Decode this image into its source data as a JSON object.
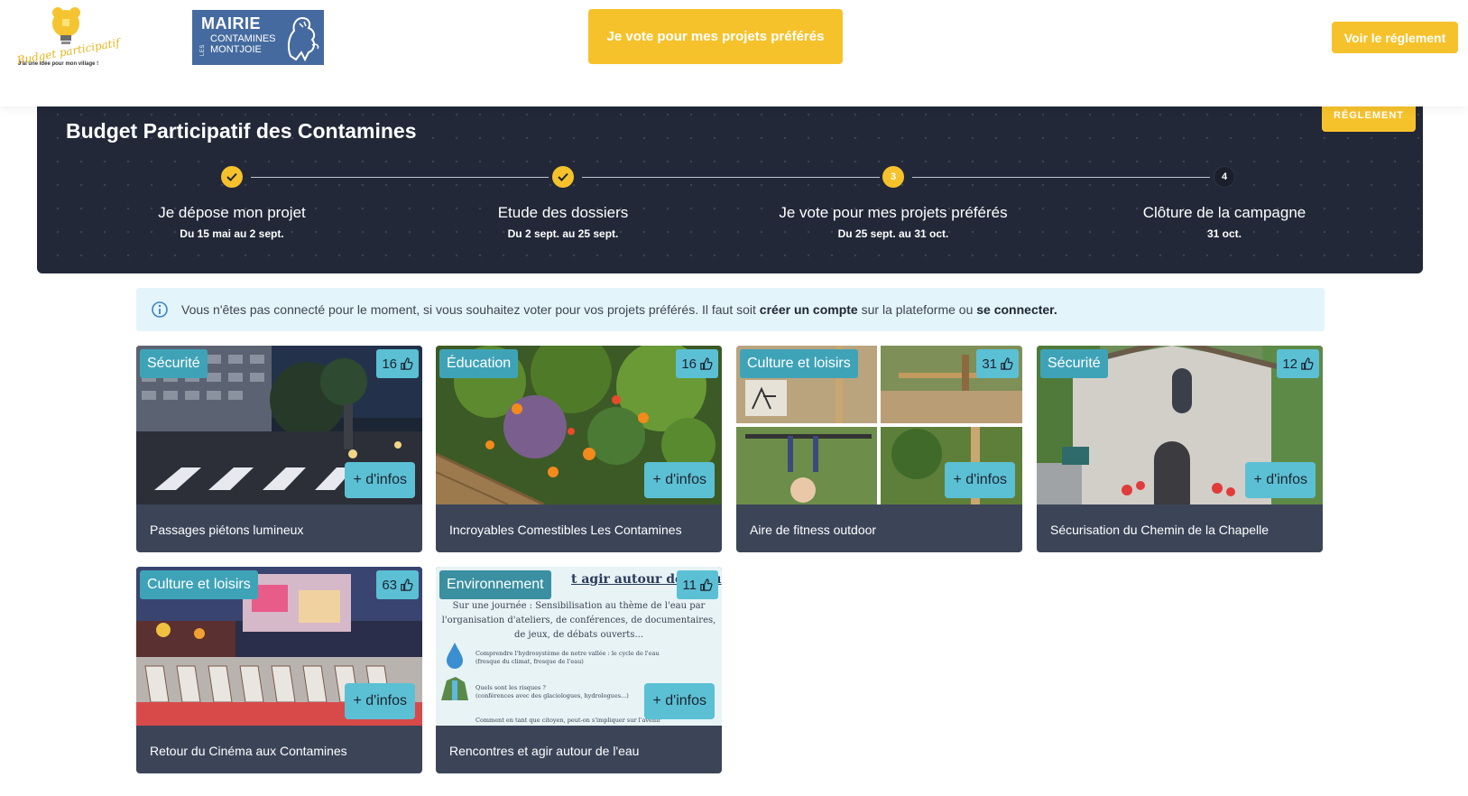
{
  "header": {
    "logo_budget": {
      "line1": "Budget participatif",
      "line2": "J'ai une idée pour mon village !"
    },
    "logo_mairie": {
      "line1": "MAIRIE",
      "line2": "LES",
      "line3": "CONTAMINES",
      "line4": "MONTJOIE"
    },
    "vote_button": "Je vote pour mes projets préférés",
    "rules_button": "Voir le réglement"
  },
  "banner": {
    "title": "Budget Participatif des Contamines",
    "rules_tab": "RÉGLEMENT",
    "steps": [
      {
        "label": "Je dépose mon projet",
        "date": "Du 15 mai au 2 sept.",
        "state": "done",
        "number": ""
      },
      {
        "label": "Etude des dossiers",
        "date": "Du 2 sept. au 25 sept.",
        "state": "done",
        "number": ""
      },
      {
        "label": "Je vote pour mes projets préférés",
        "date": "Du 25 sept. au 31 oct.",
        "state": "current",
        "number": "3"
      },
      {
        "label": "Clôture de la campagne",
        "date": "31 oct.",
        "state": "future",
        "number": "4"
      }
    ]
  },
  "info": {
    "text_before": "Vous n'êtes pas connecté pour le moment, si vous souhaitez voter pour vos projets préférés. Il faut soit ",
    "link_create": "créer un compte",
    "text_middle": " sur la plateforme ou ",
    "link_login": "se connecter."
  },
  "more_label": "+ d'infos",
  "projects": [
    {
      "category": "Sécurité",
      "votes": "16",
      "title": "Passages piétons lumineux"
    },
    {
      "category": "Éducation",
      "votes": "16",
      "title": "Incroyables Comestibles Les Contamines"
    },
    {
      "category": "Culture et loisirs",
      "votes": "31",
      "title": "Aire de fitness outdoor"
    },
    {
      "category": "Sécurité",
      "votes": "12",
      "title": "Sécurisation du Chemin de la Chapelle"
    },
    {
      "category": "Culture et loisirs",
      "votes": "63",
      "title": "Retour du Cinéma aux Contamines"
    },
    {
      "category": "Environnement",
      "votes": "11",
      "title": "Rencontres et agir autour de l'eau"
    }
  ],
  "poster": {
    "heading": "t agir autour de l'eau",
    "intro_1": "Sur une journée : Sensibilisation au thème de l'eau par",
    "intro_2": "l'organisation d'ateliers, de conférences, de documentaires,",
    "intro_3": "de jeux, de débats ouverts...",
    "item_1a": "Comprendre l'hydrosystème de notre vallée : le cycle de l'eau",
    "item_1b": "(fresque du climat, fresque de l'eau)",
    "item_2a": "Quels sont les risques ?",
    "item_2b": "(conférences avec des glaciologues, hydrologues...)",
    "item_3": "Comment en tant que citoyen, peut-on s'impliquer sur l'avenir"
  },
  "colors": {
    "accent": "#f6c22c",
    "banner_bg": "#222838",
    "card_footer": "#3c4558",
    "category_badge": "#3fa3b8",
    "vote_badge": "#5bc0d4",
    "info_bg": "#e4f4fb"
  }
}
